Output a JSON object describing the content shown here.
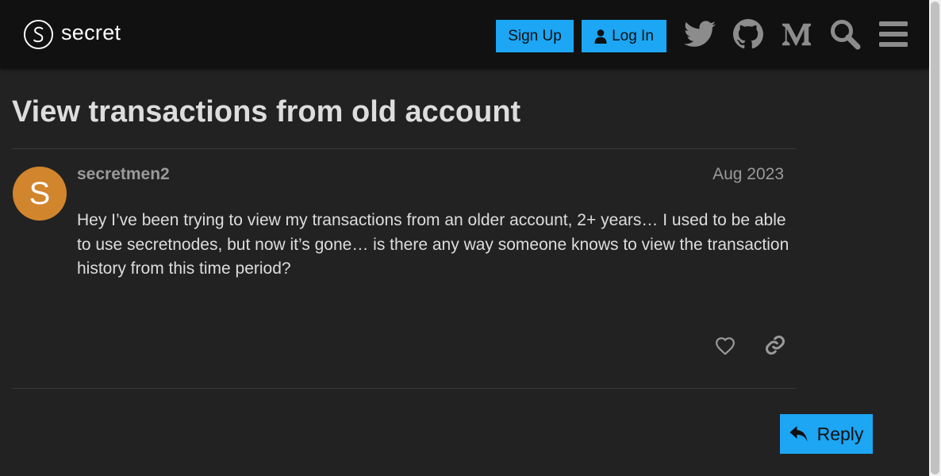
{
  "header": {
    "logo_text": "secret",
    "signup_label": "Sign Up",
    "login_label": "Log In",
    "icons": [
      "twitter-icon",
      "github-icon",
      "medium-icon",
      "search-icon",
      "hamburger-menu-icon"
    ]
  },
  "topic": {
    "title": "View transactions from old account"
  },
  "post": {
    "avatar_letter": "S",
    "avatar_color": "#d1852c",
    "username": "secretmen2",
    "date": "Aug 2023",
    "body": "Hey I’ve been trying to view my transactions from an older account, 2+ years… I used to be able to use secretnodes, but now it’s gone… is there any way someone knows to view the transaction history from this time period?"
  },
  "footer": {
    "reply_label": "Reply"
  },
  "colors": {
    "accent": "#1ca6f4",
    "header_bg": "#111111",
    "page_bg": "#222222"
  }
}
